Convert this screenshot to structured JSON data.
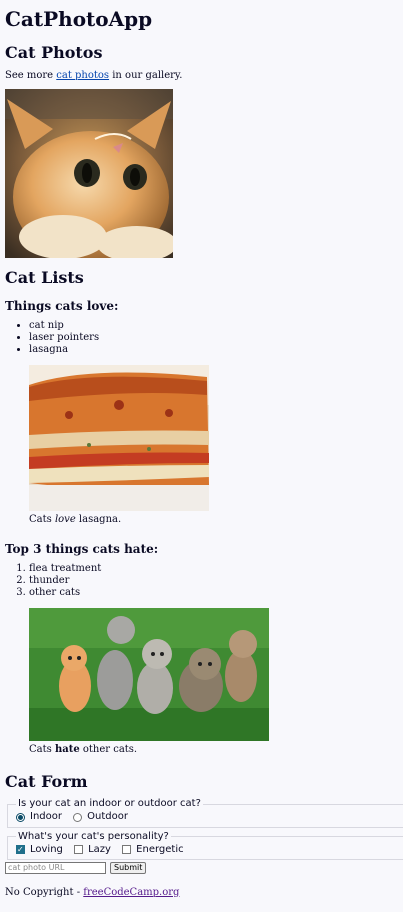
{
  "header": {
    "title": "CatPhotoApp"
  },
  "photos": {
    "heading": "Cat Photos",
    "intro_before": "See more ",
    "link_text": "cat photos",
    "intro_after": " in our gallery."
  },
  "lists": {
    "heading": "Cat Lists",
    "love_heading": "Things cats love:",
    "love_items": [
      "cat nip",
      "laser pointers",
      "lasagna"
    ],
    "lasagna_caption_before": "Cats ",
    "lasagna_caption_em": "love",
    "lasagna_caption_after": " lasagna.",
    "hate_heading": "Top 3 things cats hate:",
    "hate_items": [
      "flea treatment",
      "thunder",
      "other cats"
    ],
    "cats_caption_before": "Cats ",
    "cats_caption_strong": "hate",
    "cats_caption_after": " other cats."
  },
  "form": {
    "heading": "Cat Form",
    "location_legend": "Is your cat an indoor or outdoor cat?",
    "indoor_label": "Indoor",
    "outdoor_label": "Outdoor",
    "selected_location": "Indoor",
    "personality_legend": "What's your cat's personality?",
    "loving_label": "Loving",
    "lazy_label": "Lazy",
    "energetic_label": "Energetic",
    "url_placeholder": "cat photo URL",
    "submit_label": "Submit"
  },
  "footer": {
    "text": "No Copyright - ",
    "link_text": "freeCodeCamp.org"
  },
  "colors": {
    "background": "#f8f8fc",
    "text": "#0a0a23",
    "link": "#0645ad",
    "visited_link": "#551a8b"
  }
}
